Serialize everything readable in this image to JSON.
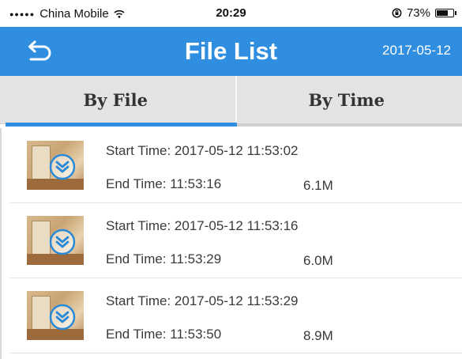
{
  "status_bar": {
    "signal": "●●●●●",
    "carrier": "China Mobile",
    "wifi_icon": "wifi-icon",
    "time": "20:29",
    "orientation_lock_icon": "rotation-lock-icon",
    "battery_percent": "73%",
    "battery_level": 0.73
  },
  "header": {
    "back_icon": "back-arrow-icon",
    "title": "File List",
    "date": "2017-05-12",
    "accent_color": "#2f8ee0"
  },
  "tabs": [
    {
      "label": "By File",
      "selected": true
    },
    {
      "label": "By Time",
      "selected": false
    }
  ],
  "files": [
    {
      "start": "Start Time: 2017-05-12 11:53:02",
      "end": "End Time: 11:53:16",
      "size": "6.1M"
    },
    {
      "start": "Start Time: 2017-05-12 11:53:16",
      "end": "End Time: 11:53:29",
      "size": "6.0M"
    },
    {
      "start": "Start Time: 2017-05-12 11:53:29",
      "end": "End Time: 11:53:50",
      "size": "8.9M"
    }
  ]
}
